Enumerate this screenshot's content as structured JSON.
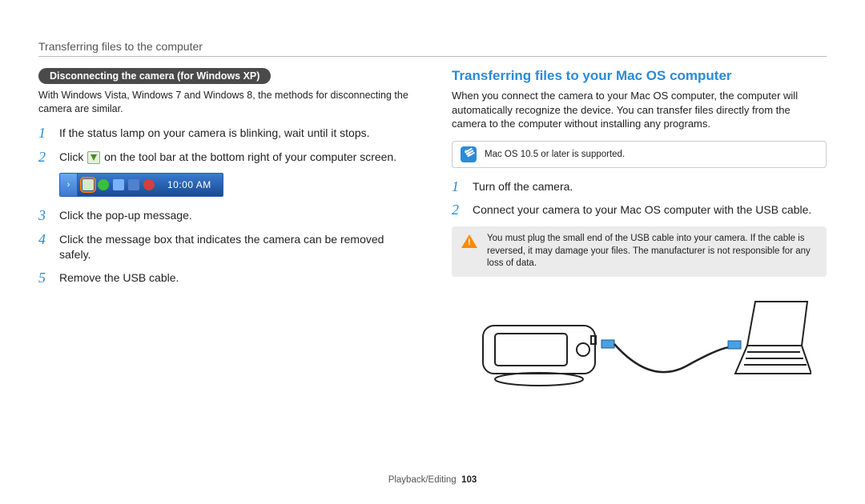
{
  "header": {
    "title": "Transferring files to the computer"
  },
  "left": {
    "pill": "Disconnecting the camera (for Windows XP)",
    "intro": "With Windows Vista, Windows 7 and Windows 8, the methods for disconnecting the camera are similar.",
    "steps": [
      "If the status lamp on your camera is blinking, wait until it stops.",
      "Click [icon] on the tool bar at the bottom right of your computer screen.",
      "Click the pop-up message.",
      "Click the message box that indicates the camera can be removed safely.",
      "Remove the USB cable."
    ],
    "step2_before": "Click ",
    "step2_after": " on the tool bar at the bottom right of your computer screen.",
    "taskbar_clock": "10:00 AM"
  },
  "right": {
    "heading": "Transferring files to your Mac OS computer",
    "intro": "When you connect the camera to your Mac OS computer, the computer will automatically recognize the device. You can transfer files directly from the camera to the computer without installing any programs.",
    "note": "Mac OS 10.5 or later is supported.",
    "steps": [
      "Turn off the camera.",
      "Connect your camera to your Mac OS computer with the USB cable."
    ],
    "warning": "You must plug the small end of the USB cable into your camera. If the cable is reversed, it may damage your files. The manufacturer is not responsible for any loss of data."
  },
  "footer": {
    "section": "Playback/Editing",
    "page": "103"
  }
}
